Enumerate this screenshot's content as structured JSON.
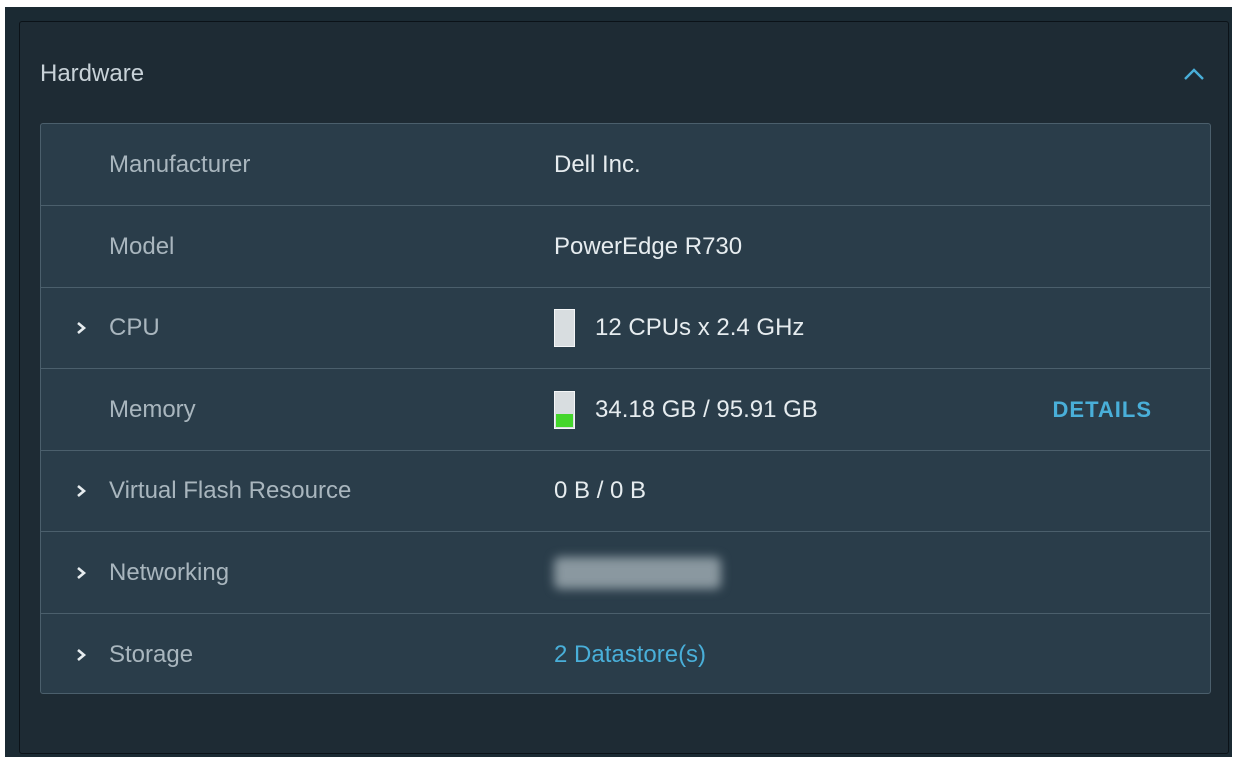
{
  "panel": {
    "title": "Hardware",
    "collapse_icon": "chevron-up-icon",
    "accent_color": "#49afd9"
  },
  "rows": [
    {
      "label": "Manufacturer",
      "value": "Dell Inc."
    },
    {
      "label": "Model",
      "value": "PowerEdge R730"
    },
    {
      "label": "CPU",
      "value": "12 CPUs x 2.4 GHz",
      "expandable": true,
      "usage_fraction": 0.0
    },
    {
      "label": "Memory",
      "value": "34.18 GB / 95.91 GB",
      "usage_fraction": 0.36,
      "action_label": "DETAILS"
    },
    {
      "label": "Virtual Flash Resource",
      "value": "0 B / 0 B",
      "expandable": true
    },
    {
      "label": "Networking",
      "value_redacted": true,
      "expandable": true
    },
    {
      "label": "Storage",
      "value": "2 Datastore(s)",
      "expandable": true,
      "value_is_link": true
    }
  ],
  "colors": {
    "memory_fill": "#44d62c",
    "link": "#49afd9"
  }
}
